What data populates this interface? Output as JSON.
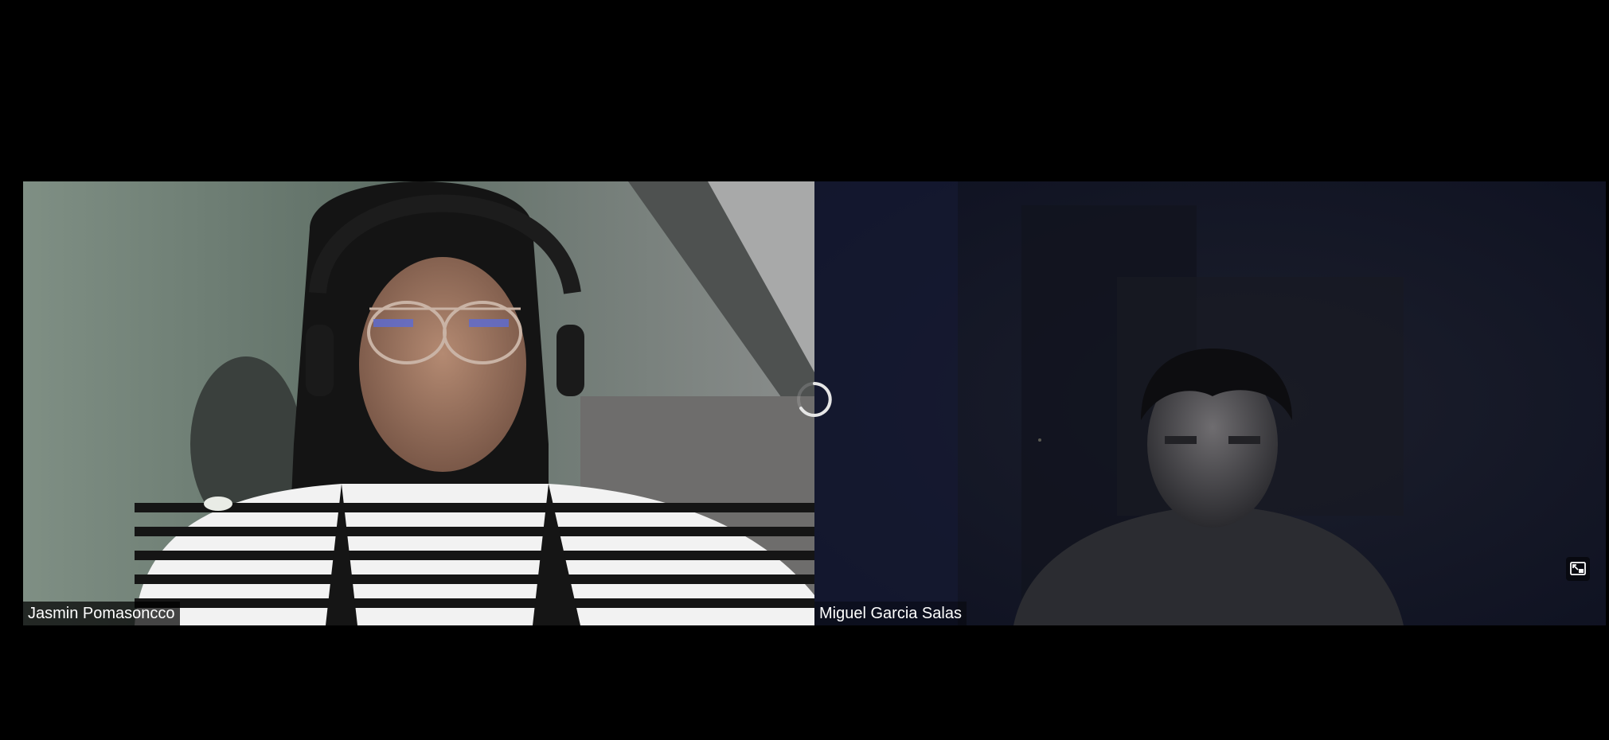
{
  "window": {
    "background_color": "#000000"
  },
  "participants": [
    {
      "name": "Jasmin Pomasoncco",
      "video": "camera-on",
      "tile_color": "#6d7a72"
    },
    {
      "name": "Miguel Garcia Salas",
      "video": "camera-on",
      "tile_color": "#14172a"
    }
  ],
  "status": {
    "loading_indicator": "spinner-icon"
  },
  "controls": {
    "pip_icon": "picture-in-picture-icon"
  }
}
